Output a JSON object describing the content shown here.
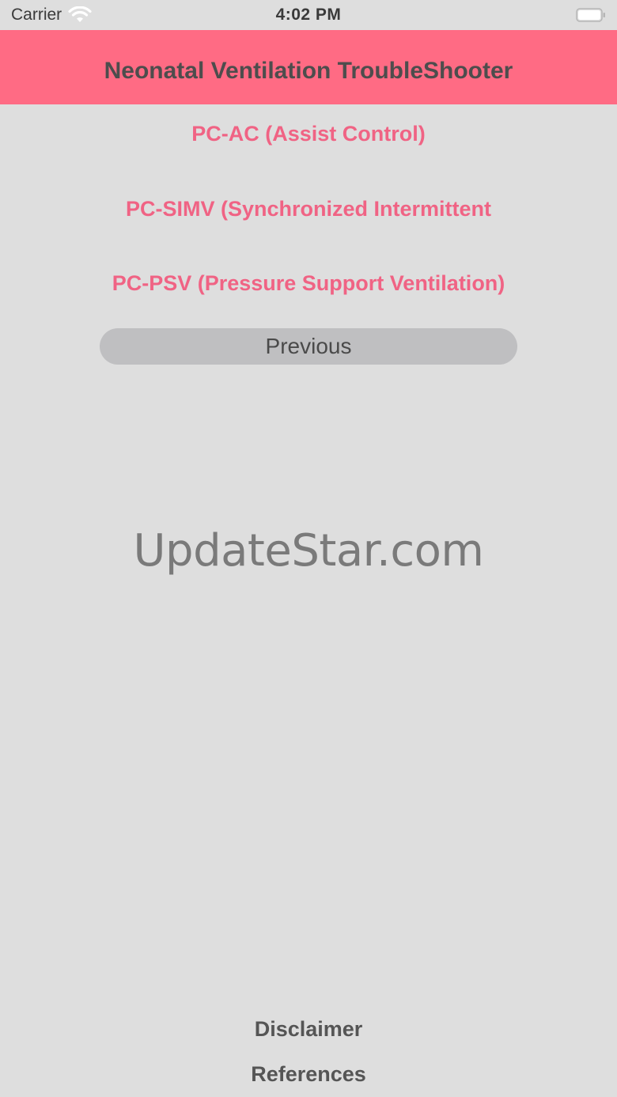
{
  "status_bar": {
    "carrier": "Carrier",
    "time": "4:02 PM",
    "wifi_icon": "wifi-icon",
    "battery_icon": "battery-icon"
  },
  "header": {
    "title": "Neonatal Ventilation TroubleShooter",
    "background_color": "#ff6b84"
  },
  "menu": {
    "items": [
      {
        "label": "PC-AC (Assist Control)"
      },
      {
        "label": "PC-SIMV (Synchronized Intermittent"
      },
      {
        "label": "PC-PSV (Pressure Support Ventilation)"
      }
    ],
    "link_color": "#f06384"
  },
  "previous_button": {
    "label": "Previous"
  },
  "watermark": {
    "text": "UpdateStar.com"
  },
  "footer": {
    "disclaimer_label": "Disclaimer",
    "references_label": "References"
  }
}
